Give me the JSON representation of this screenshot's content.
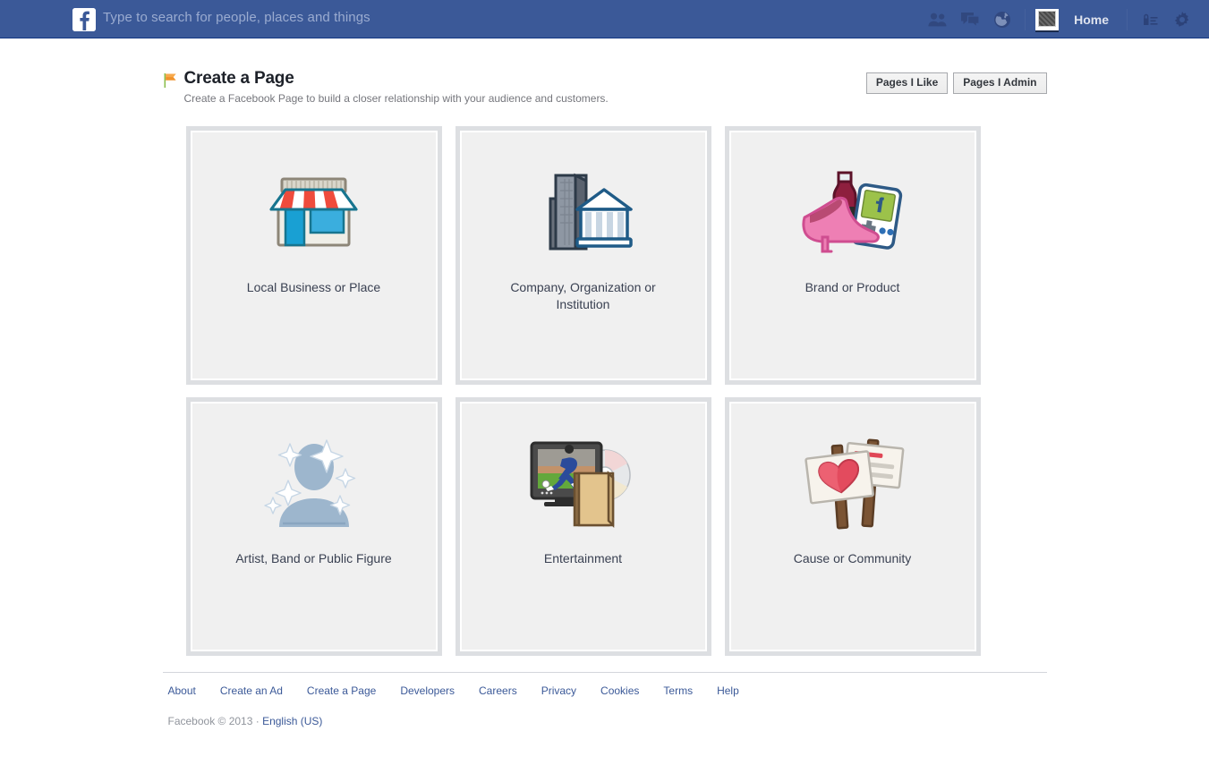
{
  "topbar": {
    "logo_alt": "facebook-logo",
    "search_placeholder": "Type to search for people, places and things",
    "home_label": "Home",
    "icons": [
      {
        "name": "friend-requests-icon",
        "label": "Friend Requests"
      },
      {
        "name": "messages-icon",
        "label": "Messages"
      },
      {
        "name": "notifications-globe-icon",
        "label": "Notifications"
      },
      {
        "name": "profile-thumbnail",
        "label": "Profile"
      },
      {
        "name": "privacy-lock-icon",
        "label": "Privacy Shortcuts"
      },
      {
        "name": "settings-gear-icon",
        "label": "Account Settings"
      }
    ],
    "bg_color": "#3b5998"
  },
  "header": {
    "flag_icon": "orange-flag-icon",
    "title": "Create a Page",
    "subtitle": "Create a Facebook Page to build a closer relationship with your audience and customers.",
    "buttons": [
      {
        "name": "pages-i-like-button",
        "label": "Pages I Like"
      },
      {
        "name": "pages-i-admin-button",
        "label": "Pages I Admin"
      }
    ]
  },
  "cards": [
    {
      "id": "local-business-or-place",
      "label": "Local Business or Place",
      "icon": "storefront-icon"
    },
    {
      "id": "company-organization-or-institution",
      "label": "Company, Organization or Institution",
      "icon": "office-buildings-icon"
    },
    {
      "id": "brand-or-product",
      "label": "Brand or Product",
      "icon": "shoe-bottle-gameboy-icon"
    },
    {
      "id": "artist-band-or-public-figure",
      "label": "Artist, Band or Public Figure",
      "icon": "sparkling-person-icon"
    },
    {
      "id": "entertainment",
      "label": "Entertainment",
      "icon": "tv-disc-book-icon"
    },
    {
      "id": "cause-or-community",
      "label": "Cause or Community",
      "icon": "protest-signs-heart-icon"
    }
  ],
  "footer": {
    "links": [
      {
        "name": "footer-link-about",
        "label": "About"
      },
      {
        "name": "footer-link-create-an-ad",
        "label": "Create an Ad"
      },
      {
        "name": "footer-link-create-a-page",
        "label": "Create a Page"
      },
      {
        "name": "footer-link-developers",
        "label": "Developers"
      },
      {
        "name": "footer-link-careers",
        "label": "Careers"
      },
      {
        "name": "footer-link-privacy",
        "label": "Privacy"
      },
      {
        "name": "footer-link-cookies",
        "label": "Cookies"
      },
      {
        "name": "footer-link-terms",
        "label": "Terms"
      },
      {
        "name": "footer-link-help",
        "label": "Help"
      }
    ],
    "copyright": "Facebook © 2013 · ",
    "language": "English (US)"
  },
  "colors": {
    "brand_blue": "#3b5998",
    "link_blue": "#3b5998",
    "card_bg": "#f0f0f0",
    "card_border": "#dddfe2",
    "muted_text": "#90949c"
  }
}
